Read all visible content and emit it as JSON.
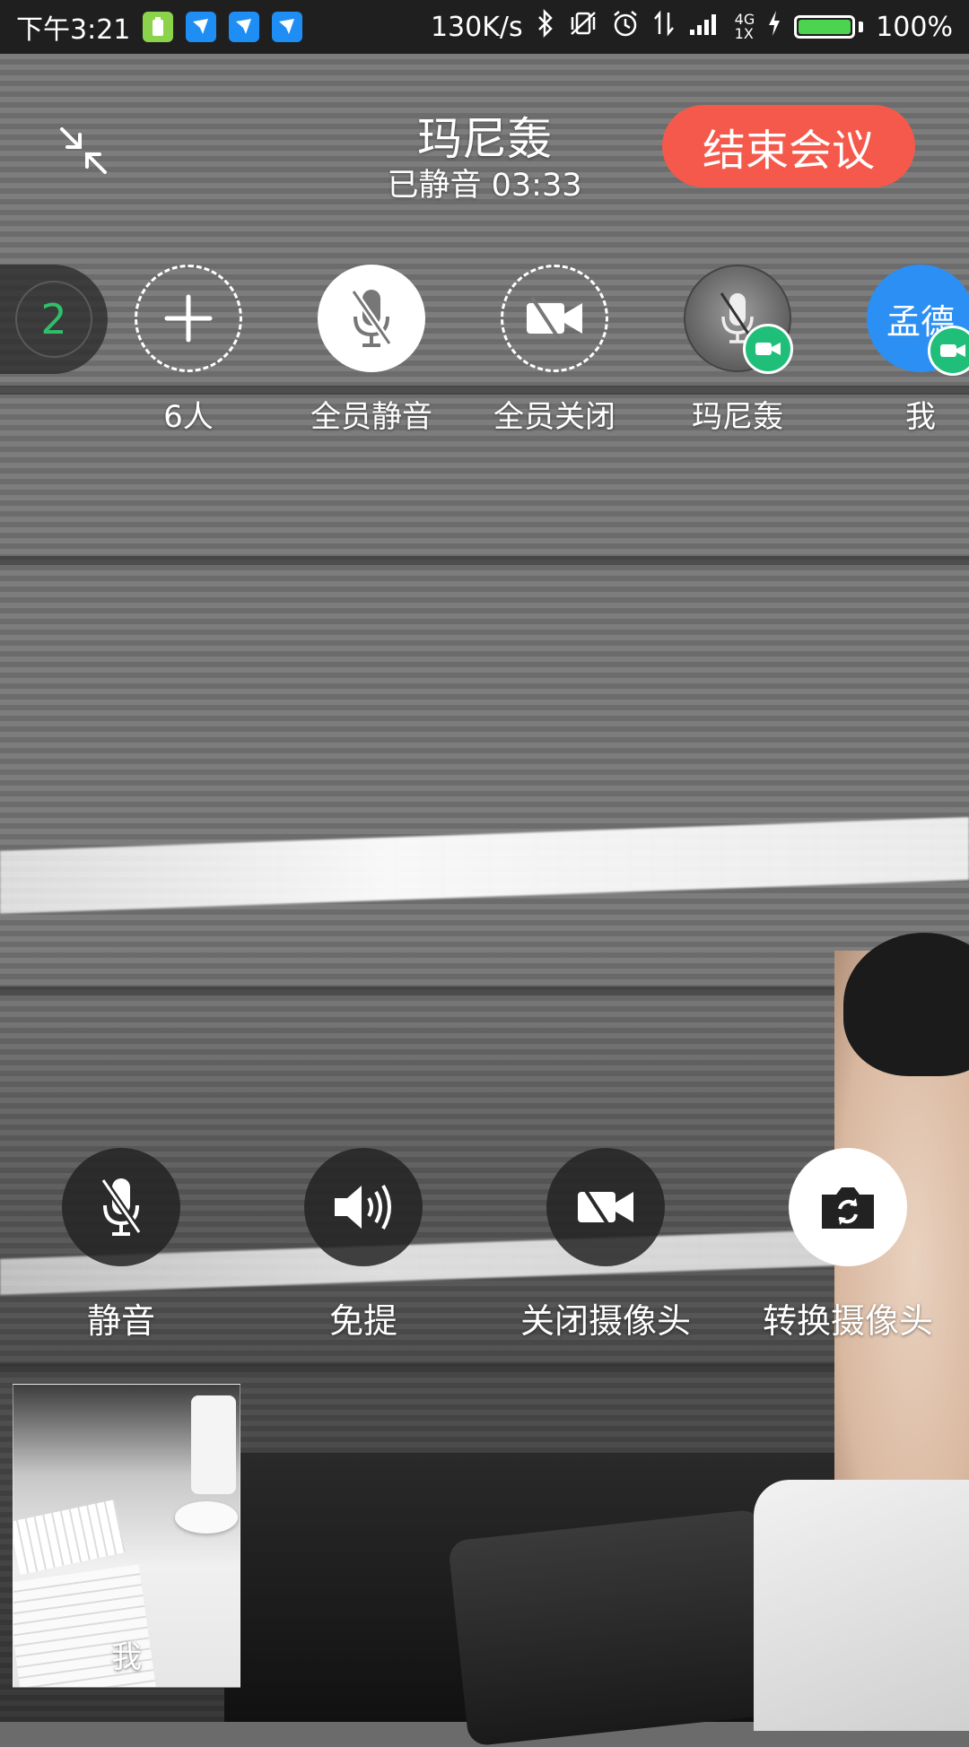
{
  "status_bar": {
    "time": "下午3:21",
    "net_speed": "130K/s",
    "network_type_top": "4G",
    "network_type_bottom": "1X",
    "battery_percent": "100%",
    "battery_level": 1.0
  },
  "header": {
    "title": "玛尼轰",
    "subtitle": "已静音 03:33",
    "end_button_label": "结束会议"
  },
  "participants": {
    "count": "2",
    "items": [
      {
        "label": "6人",
        "icon": "add-icon"
      },
      {
        "label": "全员静音",
        "icon": "mic-off-icon"
      },
      {
        "label": "全员关闭",
        "icon": "camera-off-icon"
      },
      {
        "label": "玛尼轰",
        "icon": "avatar",
        "video_on": true
      },
      {
        "label": "我",
        "avatar_text": "孟德",
        "video_on": true
      }
    ]
  },
  "controls": [
    {
      "label": "静音",
      "icon": "mic-off-icon"
    },
    {
      "label": "免提",
      "icon": "speaker-icon"
    },
    {
      "label": "关闭摄像头",
      "icon": "camera-off-icon"
    },
    {
      "label": "转换摄像头",
      "icon": "switch-camera-icon"
    }
  ],
  "self_preview": {
    "label": "我"
  },
  "colors": {
    "end_button": "#f5594b",
    "video_badge": "#1fbf7a",
    "count_text": "#2fbf6a",
    "self_avatar": "#2b8ff3"
  }
}
